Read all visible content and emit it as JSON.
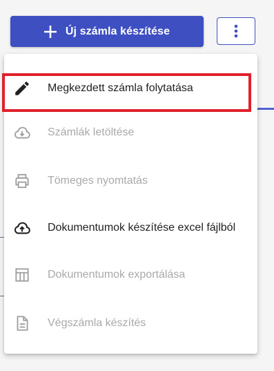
{
  "toolbar": {
    "new_button_label": "Új számla készítése"
  },
  "menu": {
    "items": [
      {
        "label": "Megkezdett számla folytatása",
        "icon": "pencil-icon",
        "enabled": true,
        "highlighted": true
      },
      {
        "label": "Számlák letöltése",
        "icon": "cloud-download-icon",
        "enabled": false
      },
      {
        "label": "Tömeges nyomtatás",
        "icon": "printer-icon",
        "enabled": false
      },
      {
        "label": "Dokumentumok készítése excel fájlból",
        "icon": "cloud-upload-icon",
        "enabled": true
      },
      {
        "label": "Dokumentumok exportálása",
        "icon": "table-icon",
        "enabled": false
      },
      {
        "label": "Végszámla készítés",
        "icon": "document-icon",
        "enabled": false
      }
    ]
  },
  "colors": {
    "primary": "#3d4fc1",
    "highlight_border": "#e0212b",
    "disabled_text": "#a9a9a9"
  }
}
